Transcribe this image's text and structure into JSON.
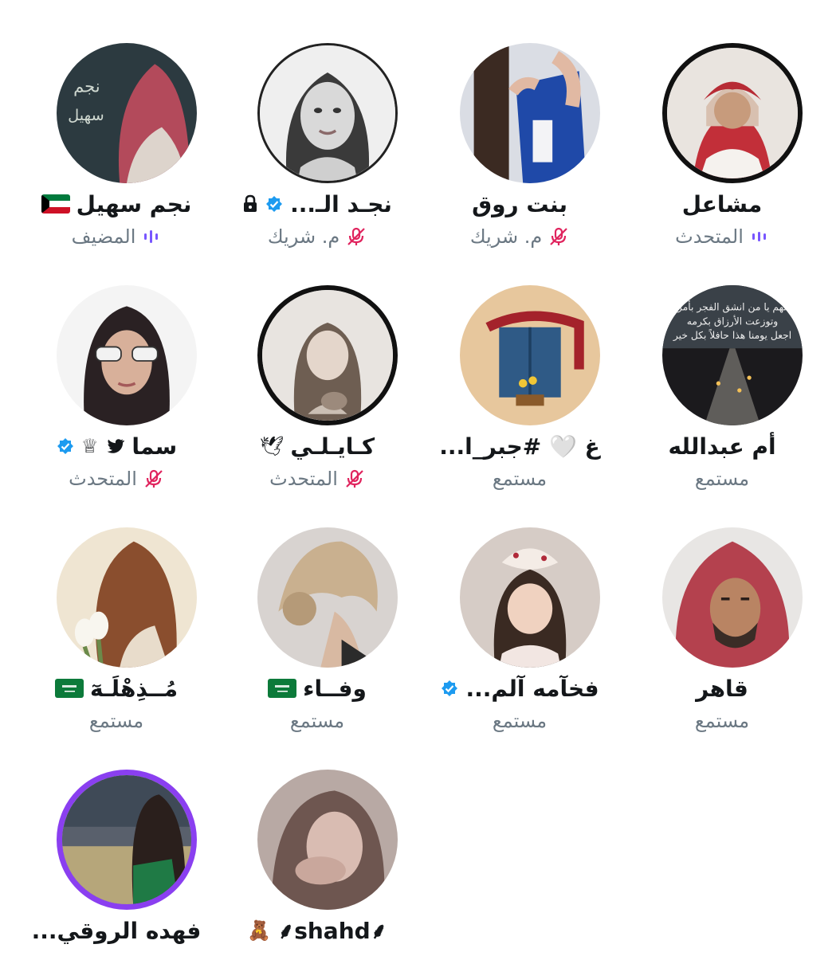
{
  "participants": [
    {
      "name": "مشاعل",
      "role": "المتحدث",
      "status_icon": "speaking-bars-icon",
      "accent": "#7856ff"
    },
    {
      "name": "بنت روق",
      "role": "م. شريك",
      "status_icon": "mic-muted-icon",
      "accent": "#e0245e"
    },
    {
      "name": "نجـد الـ...",
      "role": "م. شريك",
      "status_icon": "mic-muted-icon",
      "badges": [
        "verified-badge-icon",
        "lock-icon"
      ]
    },
    {
      "name": "نجم سهيل",
      "role": "المضيف",
      "status_icon": "speaking-bars-icon",
      "badges": [
        "kuwait-flag-icon"
      ]
    },
    {
      "name": "أم عبدالله",
      "role": "مستمع"
    },
    {
      "name": "غ 🤍 #جبر_ا...",
      "role": "مستمع"
    },
    {
      "name": "كـايـلـي",
      "role": "المتحدث",
      "status_icon": "mic-muted-icon",
      "badges": [
        "dove-icon"
      ]
    },
    {
      "name": "سما",
      "role": "المتحدث",
      "status_icon": "mic-muted-icon",
      "badges": [
        "bird-icon",
        "crown-icon",
        "verified-badge-icon"
      ]
    },
    {
      "name": "قاهر",
      "role": "مستمع"
    },
    {
      "name": "فخآمه آلم...",
      "role": "مستمع",
      "badges": [
        "verified-badge-icon"
      ]
    },
    {
      "name": "وفــاء",
      "role": "مستمع",
      "badges": [
        "saudi-flag-icon"
      ]
    },
    {
      "name": "مُــذِهْلَـهٓ",
      "role": "مستمع",
      "badges": [
        "saudi-flag-icon"
      ]
    },
    {
      "name": "⸙shahd⸙",
      "role": "",
      "badges": [
        "teddy-bear-icon"
      ]
    },
    {
      "name": "فهده الروقي...",
      "role": ""
    }
  ],
  "glyphs": {
    "dove": "🕊",
    "bird": "🐦",
    "crown": "♕",
    "teddy": "🧸"
  },
  "colors": {
    "speaking": "#7856ff",
    "muted": "#e0245e",
    "verified": "#1d9bf0",
    "name": "#14171a",
    "role": "#6b7883"
  }
}
